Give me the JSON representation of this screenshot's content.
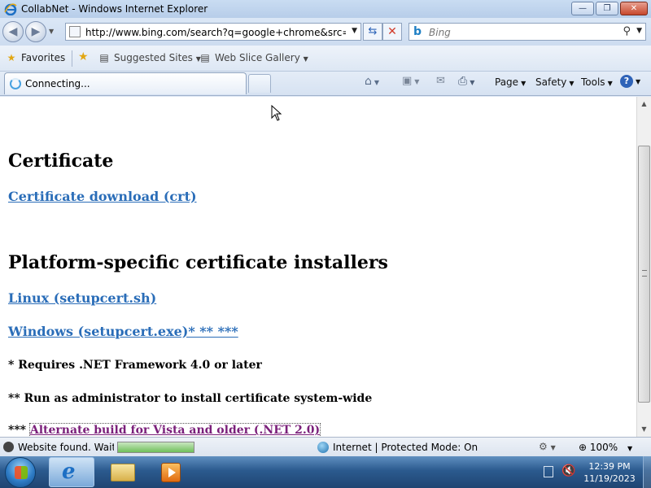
{
  "window": {
    "title": "CollabNet - Windows Internet Explorer",
    "min_glyph": "—",
    "max_glyph": "❐",
    "close_glyph": "✕"
  },
  "address_bar": {
    "url": "http://www.bing.com/search?q=google+chrome&src=IE-Se",
    "search_placeholder": "Bing"
  },
  "favorites_bar": {
    "favorites_label": "Favorites",
    "items": [
      "Suggested Sites",
      "Web Slice Gallery"
    ]
  },
  "tab": {
    "label": "Connecting..."
  },
  "command_bar": {
    "page": "Page",
    "safety": "Safety",
    "tools": "Tools",
    "help_glyph": "?"
  },
  "content": {
    "heading1": "Certificate",
    "link_certificate": "Certificate download (crt)",
    "heading2": "Platform-specific certificate installers",
    "link_linux": "Linux (setupcert.sh)",
    "link_windows": "Windows (setupcert.exe)* ** ***",
    "note1": "* Requires .NET Framework 4.0 or later",
    "note2": "** Run as administrator to install certificate system-wide",
    "note3_prefix": "***",
    "note3_link": "Alternate build for Vista and older (.NET 2.0)"
  },
  "status_bar": {
    "message": "Website found. Waiting",
    "progress_fraction": 1.0,
    "zone": "Internet | Protected Mode: On",
    "zoom": "100%"
  },
  "taskbar": {
    "time": "12:39 PM",
    "date": "11/19/2023"
  },
  "colors": {
    "link": "#2a6db8",
    "visited_link": "#7a1f7a",
    "taskbar": "#2b5a8e"
  }
}
